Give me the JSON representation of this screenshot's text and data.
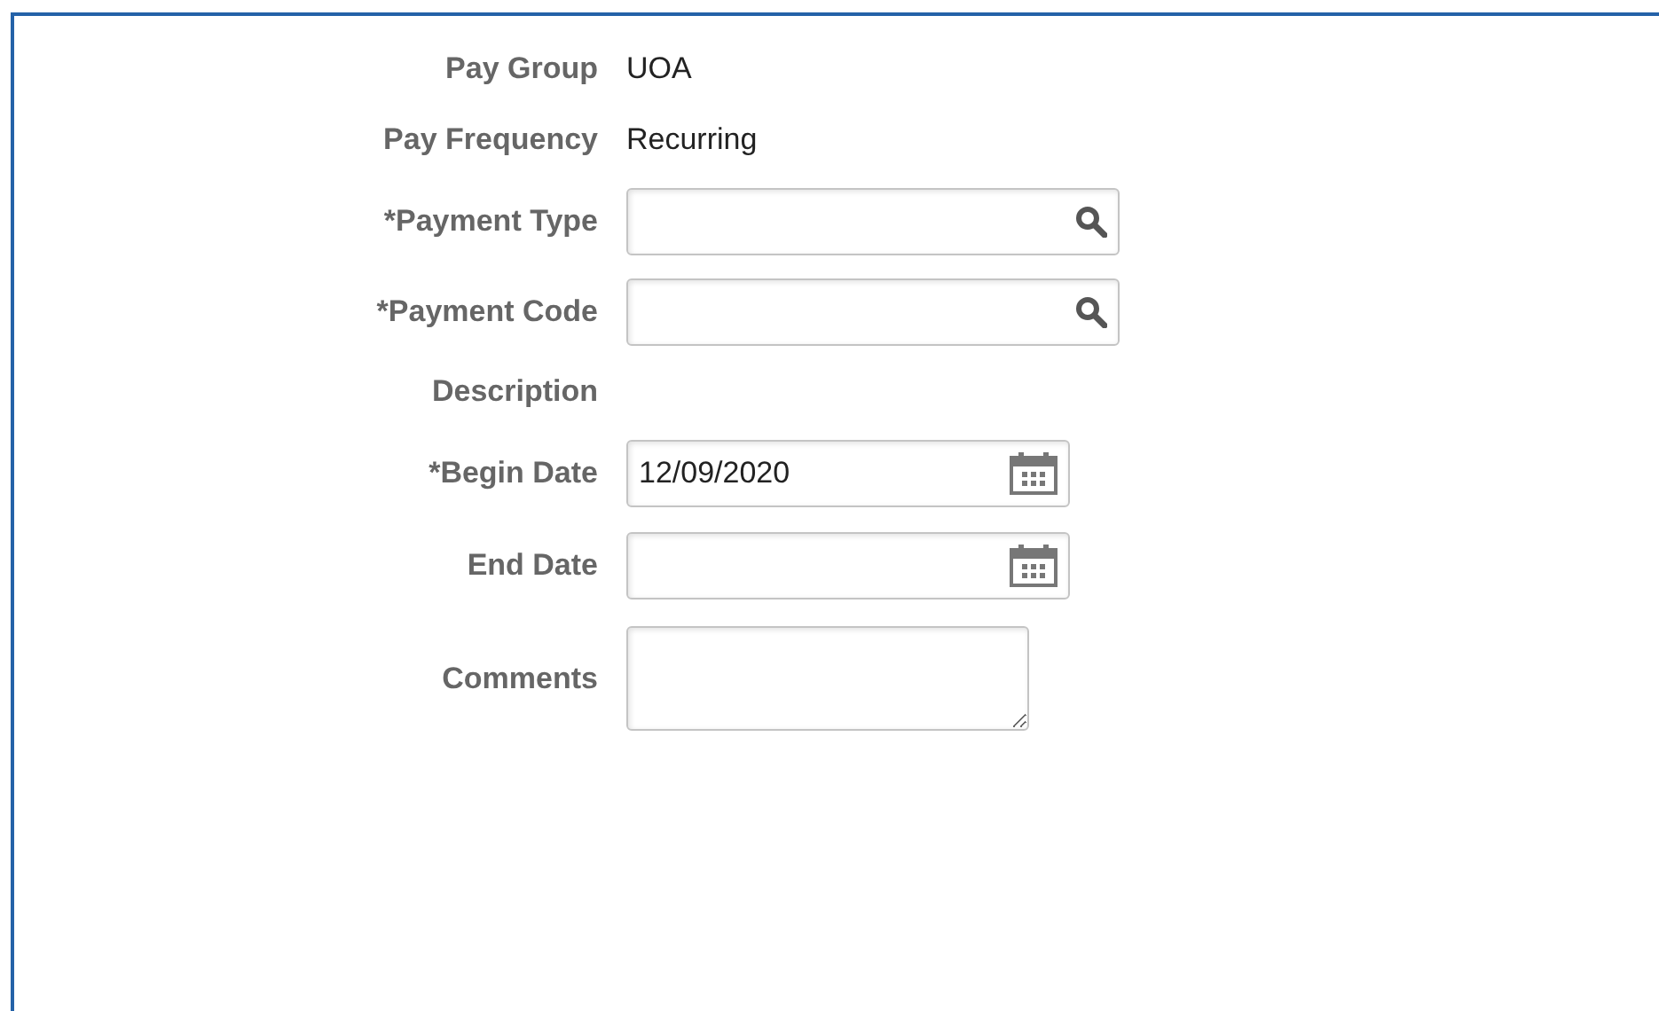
{
  "fields": [
    {
      "label": "Pay Group",
      "kind": "text",
      "value": "UOA"
    },
    {
      "label": "Pay Frequency",
      "kind": "text",
      "value": "Recurring"
    },
    {
      "label": "*Payment Type",
      "kind": "lookup"
    },
    {
      "label": "*Payment Code",
      "kind": "lookup"
    },
    {
      "label": "Description",
      "kind": "text"
    },
    {
      "label": "*Begin Date",
      "kind": "date",
      "value": "12/09/2020"
    },
    {
      "label": "End Date",
      "kind": "date"
    },
    {
      "label": "Comments",
      "kind": "textarea"
    }
  ]
}
